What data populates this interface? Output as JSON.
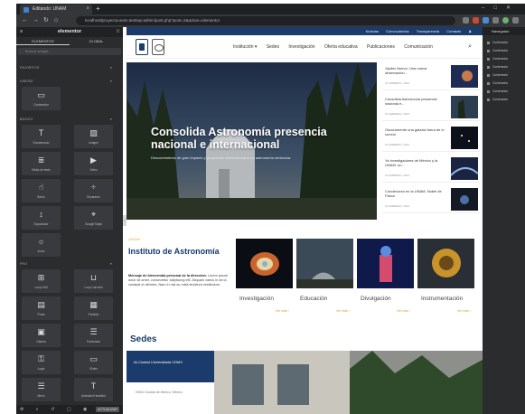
{
  "browser": {
    "tab_title": "Editando: UNAM",
    "url": "localhost/proyectounam.test/wp-admin/post.php?post=2&action=elementor",
    "new_tab": "+",
    "window_controls": "–□✕",
    "back": "←",
    "forward": "→",
    "reload": "↻",
    "home": "⌂"
  },
  "panel": {
    "title": "elementor",
    "menu_glyph": "≡",
    "grid_glyph": "⁞⁞",
    "tabs": [
      "ELEMENTOS",
      "GLOBAL"
    ],
    "search_placeholder": "Buscar widget...",
    "sections": {
      "favorites": "FAVORITOS",
      "layout": "DISEÑO",
      "basic": "BÁSICO",
      "pro": "PRO"
    },
    "layout_widgets": [
      {
        "label": "Contenedor",
        "icon": "▭"
      }
    ],
    "basic_widgets": [
      {
        "label": "Encabezado",
        "icon": "T"
      },
      {
        "label": "Imagen",
        "icon": "▨"
      },
      {
        "label": "Editor de texto",
        "icon": "≣"
      },
      {
        "label": "Video",
        "icon": "▶"
      },
      {
        "label": "Botón",
        "icon": "☝"
      },
      {
        "label": "Separador",
        "icon": "÷"
      },
      {
        "label": "Espaciador",
        "icon": "↕"
      },
      {
        "label": "Google Maps",
        "icon": "⌖"
      },
      {
        "label": "Icono",
        "icon": "☼"
      }
    ],
    "pro_widgets": [
      {
        "label": "Loop Grid",
        "icon": "⊞"
      },
      {
        "label": "Loop Carrusel",
        "icon": "⊔"
      },
      {
        "label": "Posts",
        "icon": "▤"
      },
      {
        "label": "Portfolio",
        "icon": "▦"
      },
      {
        "label": "Galería",
        "icon": "▣"
      },
      {
        "label": "Formulario",
        "icon": "☰"
      },
      {
        "label": "Login",
        "icon": "⚿"
      },
      {
        "label": "Slides",
        "icon": "▭"
      },
      {
        "label": "Menú",
        "icon": "☰"
      },
      {
        "label": "Animated Headline",
        "icon": "T"
      }
    ],
    "footer_icons": "⚙ ◐ ↺ ▢ ◉",
    "footer_button": "ACTUALIZAR",
    "collapse_glyph": "‹"
  },
  "navigator": {
    "title": "Navegador",
    "items": [
      "Contenedor",
      "Contenedor",
      "Contenedor",
      "Contenedor",
      "Contenedor",
      "Contenedor",
      "Contenedor",
      "Contenedor"
    ]
  },
  "site": {
    "top_links": [
      "Noticias",
      "Convocatorias",
      "Transparencia",
      "Contacto"
    ],
    "menu": [
      "Institución ▾",
      "Sedes",
      "Investigación",
      "Oferta educativa",
      "Publicaciones",
      "Comunicación"
    ],
    "search_icon": "⌕",
    "hero": {
      "title": "Consolida Astronomía presencia nacional e internacional",
      "subtitle": "Descubrimiento de gran impacto y proyección internacional en la astronomía mexicana."
    },
    "news": [
      {
        "title": "Júpiter Nuevo: Una nueva observación...",
        "date": "15 FEBRERO, 2024"
      },
      {
        "title": "Consolida Astronomía presencia nacional e...",
        "date": "15 FEBRERO, 2024"
      },
      {
        "title": "Oscuramente una galaxia fuera de lo común",
        "date": "15 FEBRERO, 2024"
      },
      {
        "title": "Ya investigadores de México y la UNAM, un...",
        "date": "15 FEBRERO, 2024"
      },
      {
        "title": "Condecoran en la UNAM, Nobel de Física",
        "date": "15 FEBRERO, 2024"
      }
    ],
    "institute": {
      "kicker": "UNAM",
      "title": "Instituto de Astronomía",
      "body_bold": "Mensaje de bienvenida personal de la dirección.",
      "body": "Lorem ipsum dolor sit amet, consectetur adipiscing elit. Aliquam varius in de la volutpat et ultricies. Nam in nisl ac nulla tincidunt vestibulum."
    },
    "cards": [
      {
        "title": "Investigación",
        "more": "Ver más ›"
      },
      {
        "title": "Educación",
        "more": "Ver más ›"
      },
      {
        "title": "Divulgación",
        "more": "Ver más ›"
      },
      {
        "title": "Instrumentación",
        "more": "Ver más ›"
      }
    ],
    "sedes": {
      "title": "Sedes",
      "name": "IA-Ciudad Universitaria CDMX",
      "address": "04510 Ciudad de México, México"
    }
  },
  "colors": {
    "brand_blue": "#1a3b6b",
    "accent_gold": "#e8a33a",
    "panel_dark": "#2b2c2e"
  }
}
